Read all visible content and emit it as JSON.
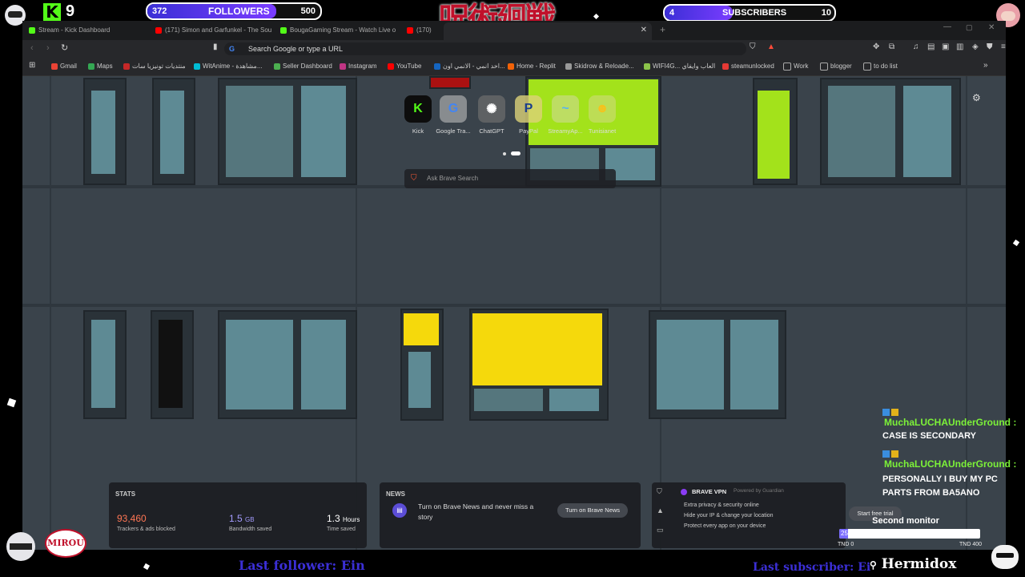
{
  "overlay": {
    "kick_logo": "K",
    "kick_count": "9",
    "followers": {
      "current": "372",
      "label": "FOLLOWERS",
      "goal": "500",
      "progress": 0.744
    },
    "subscribers": {
      "current": "4",
      "label": "SUBSCRIBERS",
      "goal": "10",
      "progress": 0.4
    },
    "jp_logo": "呪術廻戦",
    "streamer_badge": "MIROU",
    "last_follower": "Last follower: Ein",
    "last_subscriber": "Last subscriber: Ei",
    "brand": "Hermidox"
  },
  "browser": {
    "tabs": [
      {
        "label": "Stream - Kick Dashboard",
        "color": "#53fc18"
      },
      {
        "label": "(171) Simon and Garfunkel - The Sou",
        "color": "#ff0000"
      },
      {
        "label": "BougaGaming Stream - Watch Live o",
        "color": "#53fc18"
      },
      {
        "label": "(170)",
        "color": "#ff0000"
      }
    ],
    "omnibox_placeholder": "Search Google or type a URL",
    "bookmarks": [
      {
        "label": "Gmail",
        "color": "#ea4335"
      },
      {
        "label": "Maps",
        "color": "#34a853"
      },
      {
        "label": "منتديات تونيزيا سات",
        "color": "#c62828"
      },
      {
        "label": "WitAnime - مشاهدة...",
        "color": "#00bcd4"
      },
      {
        "label": "Seller Dashboard",
        "color": "#4caf50"
      },
      {
        "label": "Instagram",
        "color": "#c13584"
      },
      {
        "label": "YouTube",
        "color": "#ff0000"
      },
      {
        "label": "اخد انمي - الانمي اون...",
        "color": "#1565c0"
      },
      {
        "label": "Home - Replit",
        "color": "#f26207"
      },
      {
        "label": "Skidrow & Reloade...",
        "color": "#999999"
      },
      {
        "label": "WIFI4G... العاب وايفاي",
        "color": "#8bc34a"
      },
      {
        "label": "steamunlocked",
        "color": "#e53935"
      },
      {
        "label": "Work",
        "color": "#888888"
      },
      {
        "label": "blogger",
        "color": "#888888"
      },
      {
        "label": "to do list",
        "color": "#888888"
      }
    ],
    "speed_dial": [
      {
        "label": "Kick",
        "glyph": "K",
        "color": "#53fc18"
      },
      {
        "label": "Google Tra...",
        "glyph": "G",
        "color": "#4285f4"
      },
      {
        "label": "ChatGPT",
        "glyph": "✺",
        "color": "#ffffff"
      },
      {
        "label": "PayPal",
        "glyph": "P",
        "color": "#1a3e8c"
      },
      {
        "label": "StreamyAp...",
        "glyph": "~",
        "color": "#5ab4f0"
      },
      {
        "label": "Tunisianet",
        "glyph": "☻",
        "color": "#f6c21c"
      }
    ],
    "search_placeholder": "Ask Brave Search",
    "stats": {
      "title": "STATS",
      "blocked_value": "93,460",
      "blocked_label": "Trackers & ads blocked",
      "bandwidth_value": "1.5",
      "bandwidth_unit": "GB",
      "bandwidth_label": "Bandwidth saved",
      "time_value": "1.3",
      "time_unit": "Hours",
      "time_label": "Time saved"
    },
    "news": {
      "title": "NEWS",
      "text": "Turn on Brave News and never miss a story",
      "button": "Turn on Brave News"
    },
    "vpn": {
      "title": "BRAVE VPN",
      "powered": "Powered by Guardian",
      "features": [
        "Extra privacy & security online",
        "Hide your IP & change your location",
        "Protect every app on your device"
      ],
      "button": "Start free trial"
    }
  },
  "chat": [
    {
      "user": "MuchaLUCHAUnderGround :",
      "message": "CASE IS SECONDARY"
    },
    {
      "user": "MuchaLUCHAUnderGround :",
      "message": "PERSONALLY I BUY MY PC PARTS FROM BA5ANO"
    }
  ],
  "second_monitor": {
    "label": "Second monitor",
    "value": "25",
    "min": "TND 0",
    "max": "TND 400",
    "progress": 0.06
  }
}
